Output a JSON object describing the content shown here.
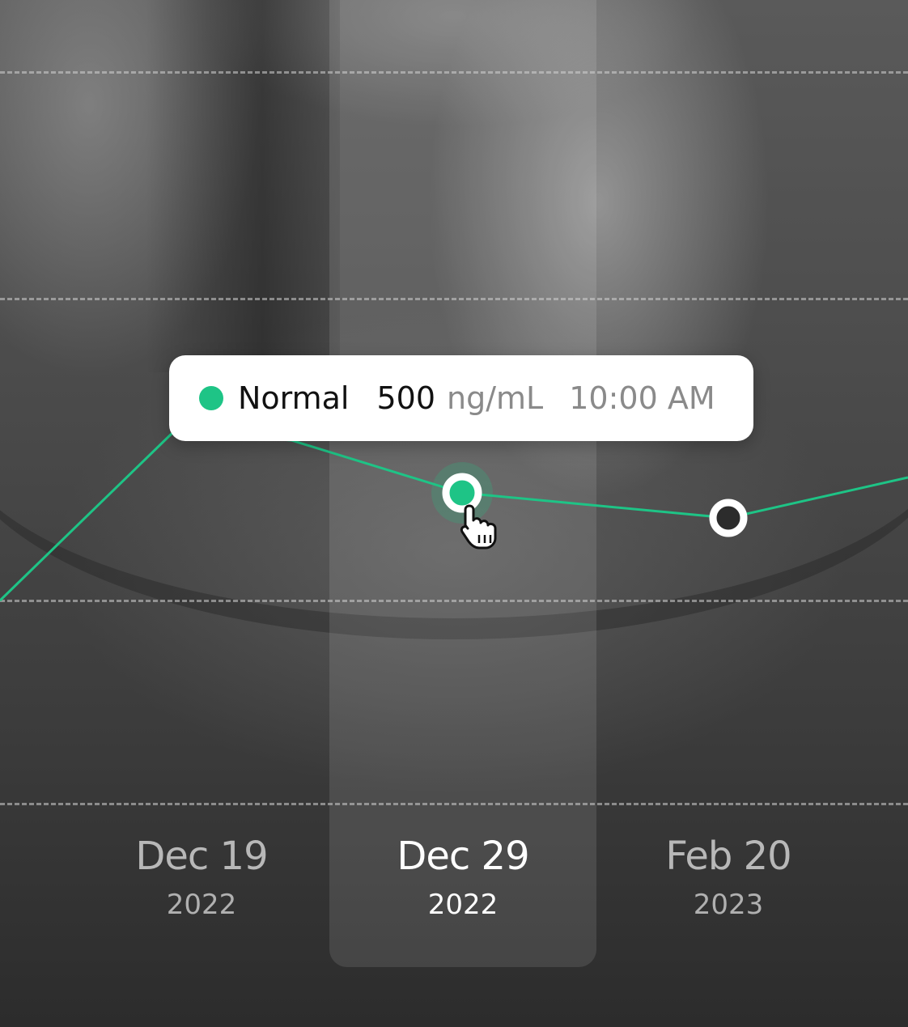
{
  "chart_data": {
    "type": "line",
    "x": [
      "Dec 19 2022",
      "Dec 29 2022",
      "Feb 20 2023"
    ],
    "categories": [
      {
        "date": "Dec 19",
        "year": "2022"
      },
      {
        "date": "Dec 29",
        "year": "2022"
      },
      {
        "date": "Feb 20",
        "year": "2023"
      }
    ],
    "selected_index": 1,
    "series": [
      {
        "values": [
          null,
          500,
          null
        ],
        "color": "#1ec486"
      }
    ],
    "unit": "ng/mL",
    "grid": true,
    "line_color": "#1ec486",
    "highlight_color": "#ffffff"
  },
  "tooltip": {
    "status": "Normal",
    "status_color": "#1ec486",
    "value": "500",
    "unit": "ng/mL",
    "time": "10:00 AM"
  },
  "cursor_icon": "hand-pointer-icon"
}
